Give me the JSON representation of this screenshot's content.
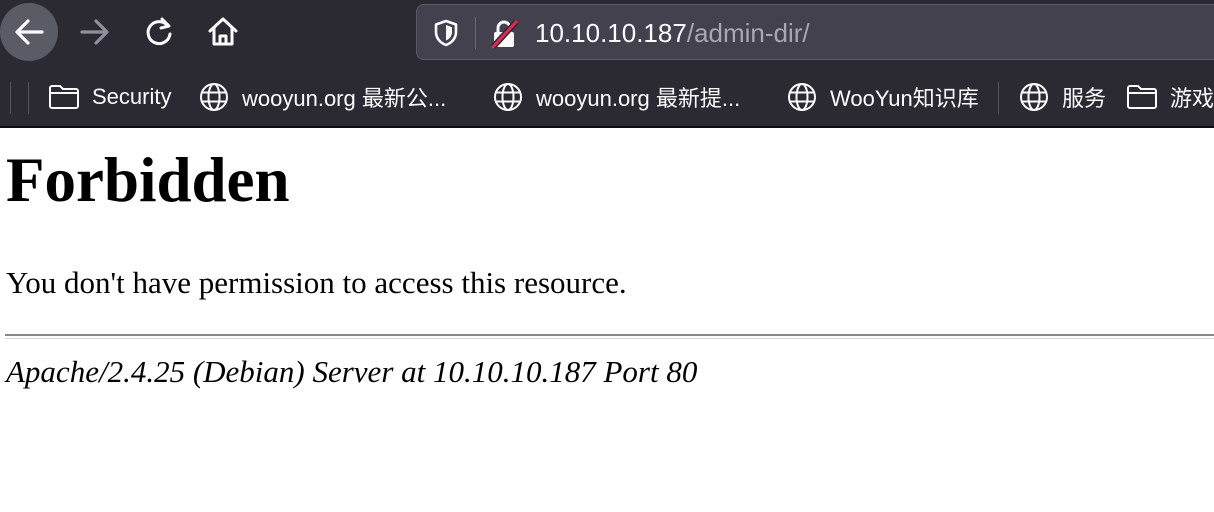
{
  "browser": {
    "url_host": "10.10.10.187",
    "url_path": "/admin-dir/",
    "bookmarks": [
      {
        "label": "Security",
        "icon": "folder-icon"
      },
      {
        "label": "wooyun.org 最新公...",
        "icon": "globe-icon"
      },
      {
        "label": "wooyun.org 最新提...",
        "icon": "globe-icon"
      },
      {
        "label": "WooYun知识库",
        "icon": "globe-icon"
      },
      {
        "label": "服务",
        "icon": "globe-icon"
      },
      {
        "label": "游戏攻",
        "icon": "folder-icon"
      }
    ]
  },
  "page": {
    "title": "Forbidden",
    "message": "You don't have permission to access this resource.",
    "signature": "Apache/2.4.25 (Debian) Server at 10.10.10.187 Port 80"
  },
  "colors": {
    "chrome_bg": "#2b2a33",
    "urlbar_bg": "#42414d",
    "insecure_red": "#e22850"
  }
}
